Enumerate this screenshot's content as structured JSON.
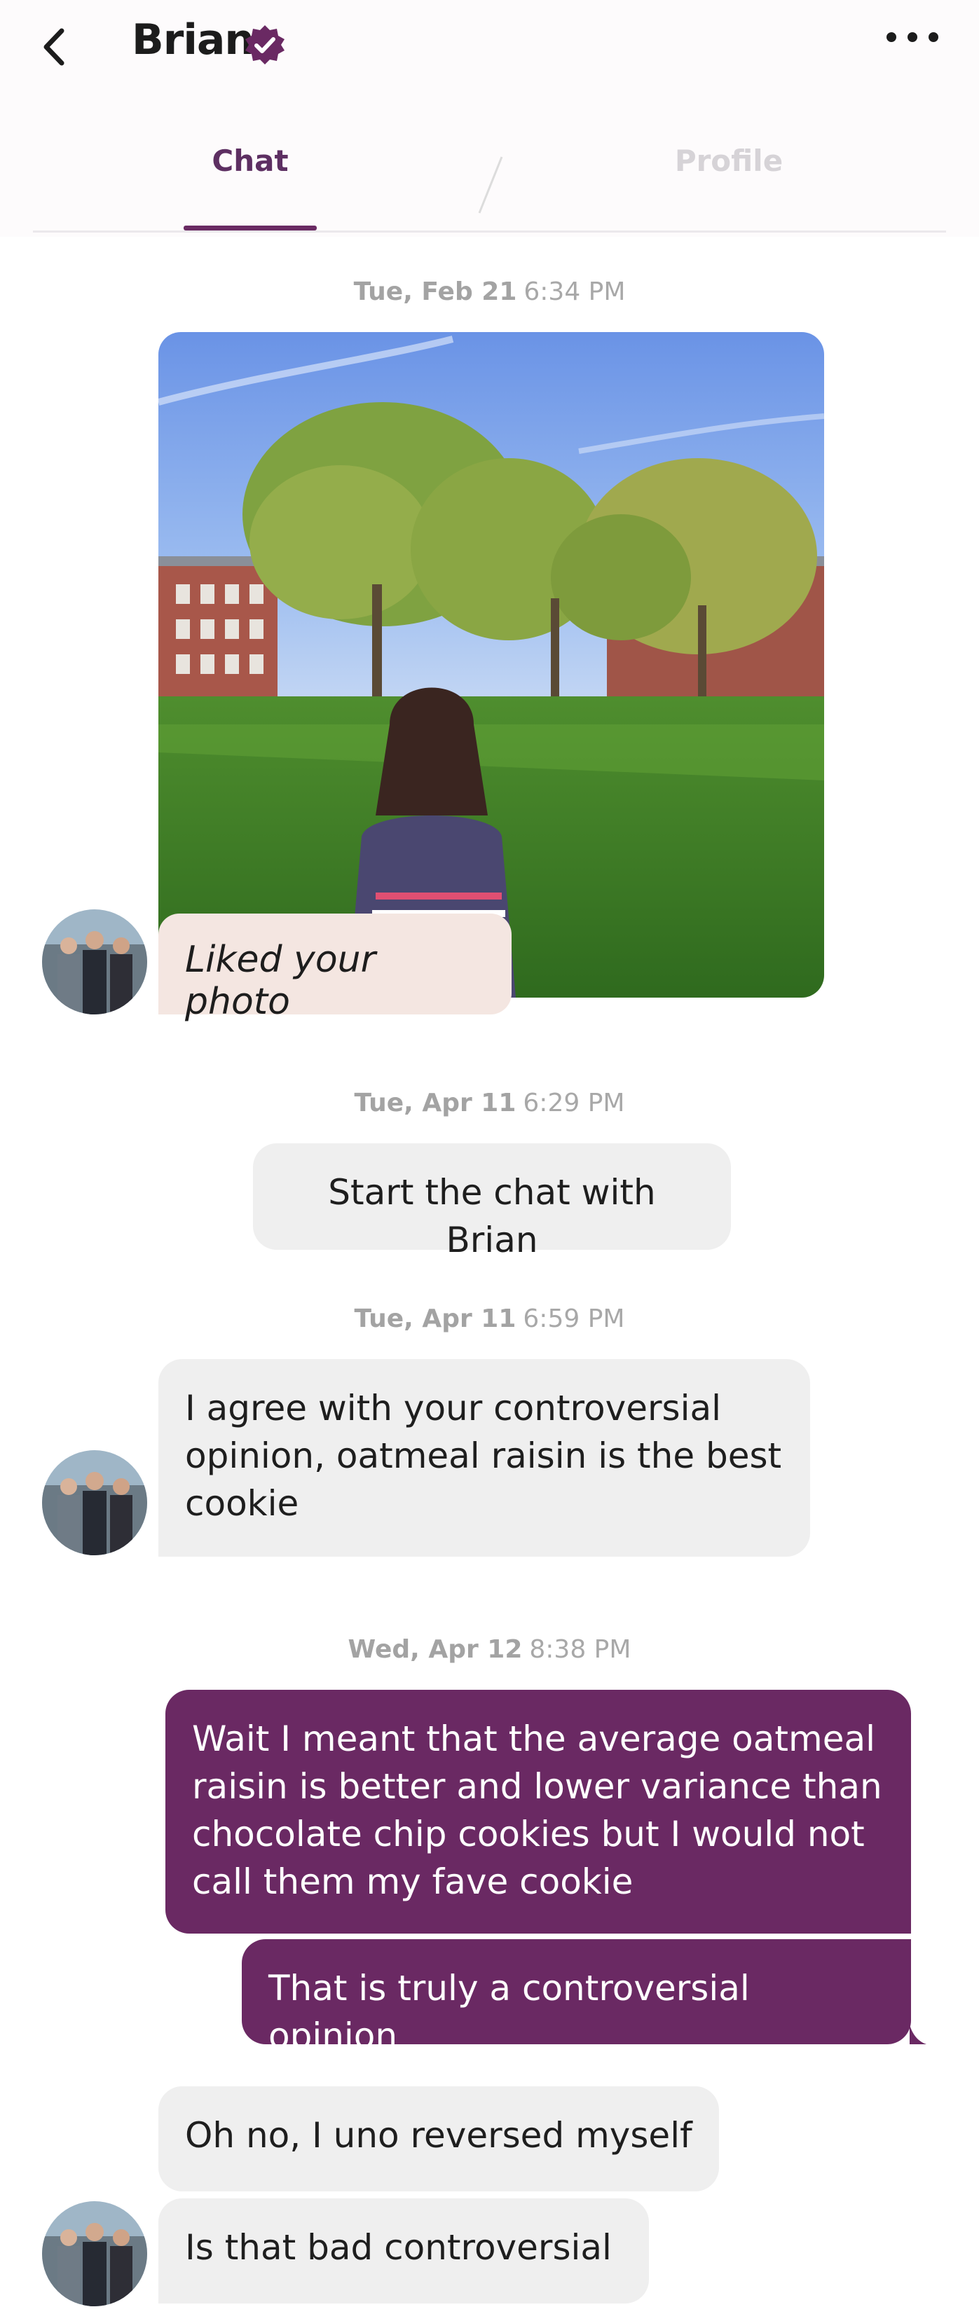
{
  "header": {
    "back_icon": "chevron-left-icon",
    "contact_name": "Brian",
    "verified_icon": "verified-badge-icon",
    "menu_icon": "more-horizontal-icon"
  },
  "tabs": [
    {
      "label": "Chat",
      "active": true
    },
    {
      "label": "Profile",
      "active": false
    }
  ],
  "colors": {
    "accent": "#6a2963",
    "liked_bubble": "#f4e6e1",
    "incoming_bubble": "#efefef",
    "outgoing_bubble": "#6a2963"
  },
  "messages": {
    "ts1": {
      "date": "Tue, Feb 21",
      "time": "6:34 PM"
    },
    "photo_like": {
      "caption": "Liked your photo"
    },
    "ts2": {
      "date": "Tue, Apr 11",
      "time": "6:29 PM"
    },
    "start_prompt": "Start the chat with Brian",
    "ts3": {
      "date": "Tue, Apr 11",
      "time": "6:59 PM"
    },
    "msg1": "I agree with your controversial opinion, oatmeal raisin is the best cookie",
    "ts4": {
      "date": "Wed, Apr 12",
      "time": "8:38 PM"
    },
    "msg2": "Wait I meant that the average oatmeal raisin is better and lower variance than chocolate chip cookies but I would not call them my fave cookie",
    "msg3": "That is truly a controversial opinion",
    "msg4": "Oh no, I uno reversed myself",
    "msg5": "Is that bad controversial"
  }
}
